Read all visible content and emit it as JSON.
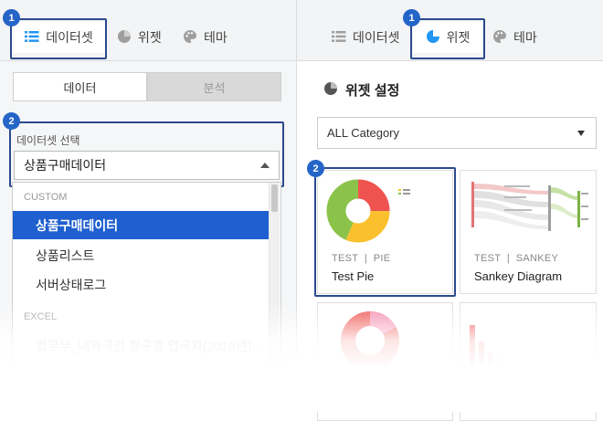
{
  "left_panel": {
    "tabs": [
      {
        "label": "데이터셋",
        "icon": "list-icon",
        "active": true
      },
      {
        "label": "위젯",
        "icon": "pie-icon",
        "active": false
      },
      {
        "label": "테마",
        "icon": "palette-icon",
        "active": false
      }
    ],
    "step_badge_1": "1",
    "step_badge_2": "2",
    "subtabs": [
      {
        "label": "데이터",
        "active": true
      },
      {
        "label": "분석",
        "active": false
      }
    ],
    "dataset_select": {
      "label": "데이터셋 선택",
      "value": "상품구매데이터",
      "groups": [
        {
          "name": "CUSTOM",
          "items": [
            {
              "label": "상품구매데이터",
              "selected": true
            },
            {
              "label": "상품리스트",
              "selected": false
            },
            {
              "label": "서버상태로그",
              "selected": false
            }
          ]
        },
        {
          "name": "EXCEL",
          "items": [
            {
              "label": "법무부_내외국인 항구별 입국자(2018년)...",
              "selected": false
            }
          ]
        }
      ]
    }
  },
  "right_panel": {
    "tabs": [
      {
        "label": "데이터셋",
        "icon": "list-icon",
        "active": false
      },
      {
        "label": "위젯",
        "icon": "pie-icon",
        "active": true
      },
      {
        "label": "테마",
        "icon": "palette-icon",
        "active": false
      }
    ],
    "step_badge_1": "1",
    "step_badge_2": "2",
    "section_title": "위젯 설정",
    "category_select": {
      "value": "ALL Category"
    },
    "cards": [
      {
        "tag": "TEST",
        "type": "PIE",
        "name": "Test Pie"
      },
      {
        "tag": "TEST",
        "type": "SANKEY",
        "name": "Sankey Diagram"
      },
      {
        "tag": "",
        "type": "",
        "name": ""
      },
      {
        "tag": "",
        "type": "",
        "name": ""
      }
    ]
  },
  "colors": {
    "accent": "#1f5fcf",
    "highlight_border": "#2b4a8e",
    "badge": "#2565c7",
    "pie_red": "#ef5350",
    "pie_yellow": "#fbc02d",
    "pie_green": "#8bc34a"
  }
}
